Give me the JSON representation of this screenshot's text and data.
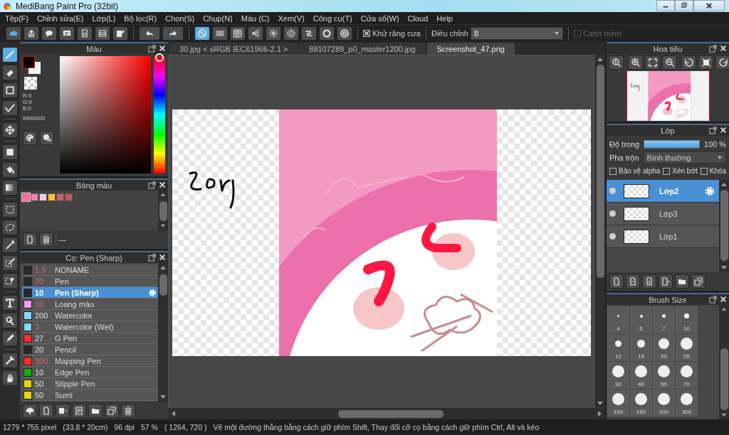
{
  "window": {
    "title": "MediBang Paint Pro (32bit)"
  },
  "menu": [
    "Tệp(F)",
    "Chỉnh sửa(E)",
    "Lớp(L)",
    "Bộ lọc(R)",
    "Chọn(S)",
    "Chụp(N)",
    "Màu (C)",
    "Xem(V)",
    "Công cụ(T)",
    "Cửa sổ(W)",
    "Cloud",
    "Help"
  ],
  "toolbar": {
    "snaps": [
      {
        "selected": true
      },
      {
        "selected": false
      },
      {
        "selected": false
      },
      {
        "selected": false
      },
      {
        "selected": false
      },
      {
        "selected": false
      },
      {
        "selected": false
      },
      {
        "selected": false
      },
      {
        "selected": false
      }
    ],
    "antialias": {
      "label": "Khử răng cưa",
      "checked": true
    },
    "adjust": {
      "label": "Điều chỉnh",
      "value": "8"
    },
    "soft_edge": {
      "label": "Cạnh mềm",
      "checked": false,
      "disabled": true
    }
  },
  "tools": [
    {
      "selected": true
    },
    {
      "selected": false
    },
    {
      "selected": false
    },
    {
      "selected": false
    },
    {
      "selected": false
    },
    {
      "selected": false
    },
    {
      "selected": false
    },
    {
      "selected": false
    },
    {
      "selected": false
    },
    {
      "selected": false
    },
    {
      "selected": false
    },
    {
      "selected": false
    },
    {
      "selected": false
    },
    {
      "selected": false
    },
    {
      "selected": false
    },
    {
      "selected": false
    },
    {
      "selected": false
    },
    {
      "selected": false
    }
  ],
  "color_panel": {
    "title": "Màu",
    "r": "R:0",
    "g": "G:0",
    "b": "B:0",
    "hex": "#000000"
  },
  "palette_panel": {
    "title": "Bảng màu",
    "swatches": [
      {
        "color": "#f06fa0",
        "selected": true
      },
      {
        "color": "#ee82b5",
        "selected": false
      },
      {
        "color": "#f0cfe6",
        "selected": false
      },
      {
        "color": "#f5c030",
        "selected": false
      },
      {
        "color": "#c86070",
        "selected": false
      },
      {
        "color": "#c05858",
        "selected": false
      }
    ],
    "name": "---"
  },
  "brush_panel": {
    "title": "Cọ: Pen (Sharp)",
    "brushes": [
      {
        "size": "1.5",
        "name": "NONAME",
        "color": "#2a2a2a",
        "size_alt": true,
        "selected": false
      },
      {
        "size": "70",
        "name": "Pen",
        "color": "#2a2a2a",
        "size_alt": true,
        "selected": false
      },
      {
        "size": "10",
        "name": "Pen (Sharp)",
        "color": "#2a2a2a",
        "size_alt": false,
        "selected": true
      },
      {
        "size": "10",
        "name": "Loang màu",
        "color": "#f3a0f0",
        "size_alt": true,
        "selected": false
      },
      {
        "size": "200",
        "name": "Watercolor",
        "color": "#80d8ff",
        "size_alt": false,
        "selected": false
      },
      {
        "size": "3",
        "name": "Watercolor (Wet)",
        "color": "#80d8ff",
        "size_alt": true,
        "selected": false
      },
      {
        "size": "27",
        "name": "G Pen",
        "color": "#ff2a2a",
        "size_alt": false,
        "selected": false
      },
      {
        "size": "20",
        "name": "Pencil",
        "color": "#2a2a2a",
        "size_alt": false,
        "selected": false
      },
      {
        "size": "300",
        "name": "Mapping Pen",
        "color": "#ff2a2a",
        "size_alt": true,
        "selected": false
      },
      {
        "size": "10",
        "name": "Edge Pen",
        "color": "#10b010",
        "size_alt": false,
        "selected": false
      },
      {
        "size": "50",
        "name": "Stipple Pen",
        "color": "#e8d800",
        "size_alt": false,
        "selected": false
      },
      {
        "size": "50",
        "name": "Sumi",
        "color": "#e8d800",
        "size_alt": false,
        "selected": false
      }
    ]
  },
  "tabs": [
    {
      "label": "30.jpg < sRGB IEC61966-2.1 >",
      "selected": false
    },
    {
      "label": "88107289_p0_master1200.jpg",
      "selected": false
    },
    {
      "label": "Screenshot_47.png",
      "selected": true
    }
  ],
  "navigator": {
    "title": "Hoa tiêu"
  },
  "layer_panel": {
    "title": "Lớp",
    "opacity_label": "Độ trong",
    "opacity": {
      "level": 1
    },
    "opacity_value": "100 %",
    "blend_label": "Pha trộn",
    "blend_value": "Bình thường",
    "options": [
      {
        "label": "Bảo vệ alpha",
        "checked": false
      },
      {
        "label": "Xén bớt",
        "checked": false
      },
      {
        "label": "Khóa",
        "checked": false
      }
    ],
    "layers": [
      {
        "name": "Lớp2",
        "selected": true
      },
      {
        "name": "Lớp3",
        "selected": false
      },
      {
        "name": "Lớp1",
        "selected": false
      }
    ]
  },
  "brush_size_panel": {
    "title": "Brush Size",
    "sizes": [
      "4",
      "5",
      "7",
      "10",
      "12",
      "15",
      "20",
      "25",
      "30",
      "40",
      "50",
      "70",
      "100",
      "150",
      "200",
      "300"
    ]
  },
  "status_bar": {
    "size": "1279 * 755 pixel",
    "physical": "(33.8 * 20cm)",
    "dpi": "96 dpi",
    "zoom": "57 %",
    "cursor": "( 1264, 720 )",
    "hint": "Vẽ một đường thẳng bằng cách giữ phím Shift, Thay đổi cỡ cọ bằng cách giữ phím Ctrl, Alt và kéo"
  }
}
